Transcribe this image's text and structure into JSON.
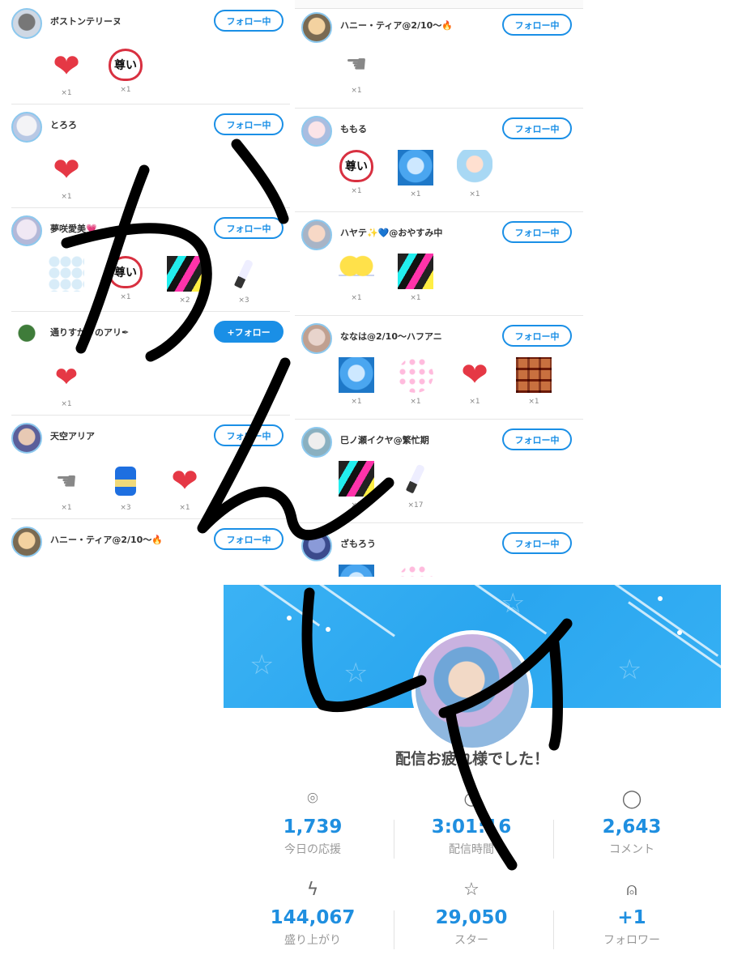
{
  "left_list": [
    {
      "name": "ボストンテリーヌ",
      "button": "フォロー中",
      "avatar": "av-a",
      "gifts": [
        {
          "kind": "heart-cat",
          "count": "×1"
        },
        {
          "kind": "toutoi",
          "count": "×1"
        }
      ]
    },
    {
      "name": "とろろ",
      "button": "フォロー中",
      "avatar": "av-b",
      "gifts": [
        {
          "kind": "heart-cat",
          "count": "×1"
        }
      ]
    },
    {
      "name": "夢咲愛美💗",
      "button": "フォロー中",
      "avatar": "av-c",
      "gifts": [
        {
          "kind": "petals",
          "count": ""
        },
        {
          "kind": "toutoi",
          "count": "×1"
        },
        {
          "kind": "spot",
          "count": "×2"
        },
        {
          "kind": "lightstick",
          "count": "×3"
        }
      ]
    },
    {
      "name": "通りすがりのアリ✒",
      "button": "+フォロー",
      "primary": true,
      "avatar": "av-d",
      "gifts": [
        {
          "kind": "daisuki",
          "count": "×1"
        }
      ]
    },
    {
      "name": "天空アリア",
      "button": "フォロー中",
      "avatar": "av-e",
      "gifts": [
        {
          "kind": "hand",
          "count": "×1"
        },
        {
          "kind": "ring",
          "count": "×3"
        },
        {
          "kind": "heart",
          "count": "×1"
        }
      ]
    },
    {
      "name": "ハニー・ティア@2/10〜🔥",
      "button": "フォロー中",
      "avatar": "av-f",
      "gifts": []
    }
  ],
  "right_list": [
    {
      "name": "ハニー・ティア@2/10〜🔥",
      "button": "フォロー中",
      "avatar": "av-f",
      "gifts": [
        {
          "kind": "hand",
          "count": "×1"
        }
      ]
    },
    {
      "name": "ももる",
      "button": "フォロー中",
      "avatar": "av-g",
      "gifts": [
        {
          "kind": "toutoi",
          "count": "×1"
        },
        {
          "kind": "disco",
          "count": "×1"
        },
        {
          "kind": "chara",
          "count": "×1"
        }
      ]
    },
    {
      "name": "ハヤテ✨💙@おやすみ中",
      "button": "フォロー中",
      "avatar": "av-h",
      "gifts": [
        {
          "kind": "balloons",
          "count": "×1"
        },
        {
          "kind": "spot",
          "count": "×1"
        }
      ]
    },
    {
      "name": "ななは@2/10〜ハフアニ",
      "button": "フォロー中",
      "avatar": "av-i",
      "gifts": [
        {
          "kind": "disco",
          "count": "×1"
        },
        {
          "kind": "glitter",
          "count": "×1"
        },
        {
          "kind": "heart-cat",
          "count": "×1"
        },
        {
          "kind": "brown",
          "count": "×1"
        }
      ]
    },
    {
      "name": "巳ノ瀬イクヤ@繁忙期",
      "button": "フォロー中",
      "avatar": "av-j",
      "gifts": [
        {
          "kind": "spot",
          "count": "×1"
        },
        {
          "kind": "lightstick",
          "count": "×17"
        }
      ]
    },
    {
      "name": "ざもろう",
      "button": "フォロー中",
      "avatar": "av-k",
      "gifts": [
        {
          "kind": "disco",
          "count": ""
        },
        {
          "kind": "glitter",
          "count": ""
        }
      ]
    }
  ],
  "summary": {
    "message": "配信お疲れ様でした！",
    "stats": [
      {
        "icon": "flame-icon",
        "glyph": "⌾",
        "value": "1,739",
        "label": "今日の応援"
      },
      {
        "icon": "clock-icon",
        "glyph": "◷",
        "value": "3:01:16",
        "label": "配信時間"
      },
      {
        "icon": "comment-icon",
        "glyph": "◯",
        "value": "2,643",
        "label": "コメント"
      },
      {
        "icon": "lightning-icon",
        "glyph": "ϟ",
        "value": "144,067",
        "label": "盛り上がり"
      },
      {
        "icon": "star-icon",
        "glyph": "☆",
        "value": "29,050",
        "label": "スター"
      },
      {
        "icon": "person-icon",
        "glyph": "⍝",
        "value": "+1",
        "label": "フォロワー"
      }
    ]
  },
  "colors": {
    "accent": "#1a8fe6",
    "value": "#1f8fe0",
    "banner": "#2aa6ef",
    "ink": "#000000"
  }
}
